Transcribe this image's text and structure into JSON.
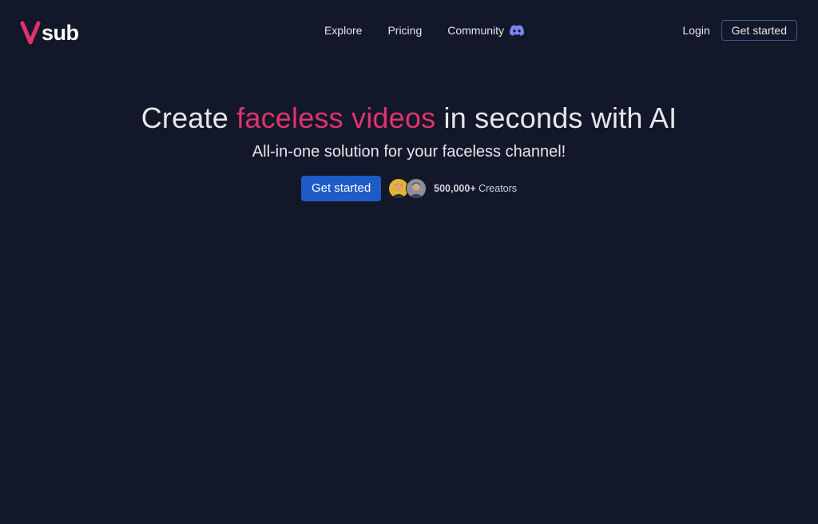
{
  "brand": {
    "name": "sub",
    "accent_color": "#e0336e",
    "logo_icon": "v-logo-icon"
  },
  "nav": {
    "items": [
      {
        "label": "Explore"
      },
      {
        "label": "Pricing"
      },
      {
        "label": "Community",
        "icon": "discord-icon"
      }
    ]
  },
  "auth": {
    "login_label": "Login",
    "get_started_label": "Get started"
  },
  "hero": {
    "title_prefix": "Create ",
    "title_highlight": "faceless videos",
    "title_suffix": " in seconds with AI",
    "subtitle": "All-in-one solution for your faceless channel!",
    "cta_label": "Get started",
    "creators_count": "500,000+",
    "creators_label": " Creators"
  },
  "colors": {
    "background": "#121829",
    "primary_button": "#1d5cc7",
    "outline_border": "#3b5b8f",
    "discord": "#7c83f0"
  }
}
